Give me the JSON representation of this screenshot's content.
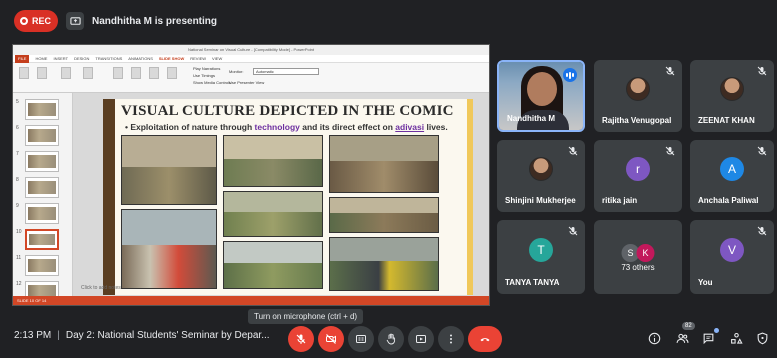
{
  "recording": {
    "label": "REC"
  },
  "presenter": {
    "text": "Nandhitha M is presenting"
  },
  "presentation": {
    "window_title": "National Seminar on Visual Culture - [Compatibility Mode] - PowerPoint",
    "tabs": [
      "FILE",
      "HOME",
      "INSERT",
      "DESIGN",
      "TRANSITIONS",
      "ANIMATIONS",
      "SLIDE SHOW",
      "REVIEW",
      "VIEW"
    ],
    "active_tab": "SLIDE SHOW",
    "ribbon_checks": [
      "Play Narrations",
      "Use Timings",
      "Show Media Controls"
    ],
    "monitor_label": "Monitor:",
    "monitor_value": "Automatic",
    "presenter_view": "Use Presenter View",
    "thumb_numbers": [
      "5",
      "6",
      "7",
      "8",
      "9",
      "10",
      "11",
      "12"
    ],
    "notes_placeholder": "Click to add notes",
    "status_text": "SLIDE 10 OF 14",
    "slide": {
      "title": "VISUAL CULTURE DEPICTED IN THE COMIC",
      "bullet_pre": "Exploitation of nature through ",
      "bullet_hl": "technology",
      "bullet_mid": " and its direct effect on ",
      "bullet_ul": "adivasi",
      "bullet_post": " lives."
    }
  },
  "participants": [
    {
      "name": "Nandhitha M",
      "active": true
    },
    {
      "name": "Rajitha Venugopal",
      "avatar": "photo",
      "muted": true
    },
    {
      "name": "ZEENAT KHAN",
      "avatar": "photo",
      "muted": true
    },
    {
      "name": "Shinjini Mukherjee",
      "avatar": "photo",
      "muted": true
    },
    {
      "name": "ritika jain",
      "initial": "r",
      "color": "#7e57c2",
      "muted": true
    },
    {
      "name": "Anchala Paliwal",
      "initial": "A",
      "color": "#1e88e5",
      "muted": true
    },
    {
      "name": "TANYA TANYA",
      "initial": "T",
      "color": "#26a69a",
      "muted": true
    },
    {
      "others_count": "73 others",
      "initials": [
        "S",
        "K"
      ],
      "colors": [
        "#5f6368",
        "#c2185b"
      ]
    },
    {
      "name": "You",
      "initial": "V",
      "color": "#7e57c2",
      "muted": true
    }
  ],
  "tooltip": "Turn on microphone (ctrl + d)",
  "meeting": {
    "time": "2:13 PM",
    "title": "Day 2: National Students' Seminar by Depar..."
  },
  "people_count": "82",
  "colors": {
    "accent": "#8ab4f8",
    "danger": "#ea4335",
    "tile": "#3c4043",
    "bg": "#202124"
  }
}
